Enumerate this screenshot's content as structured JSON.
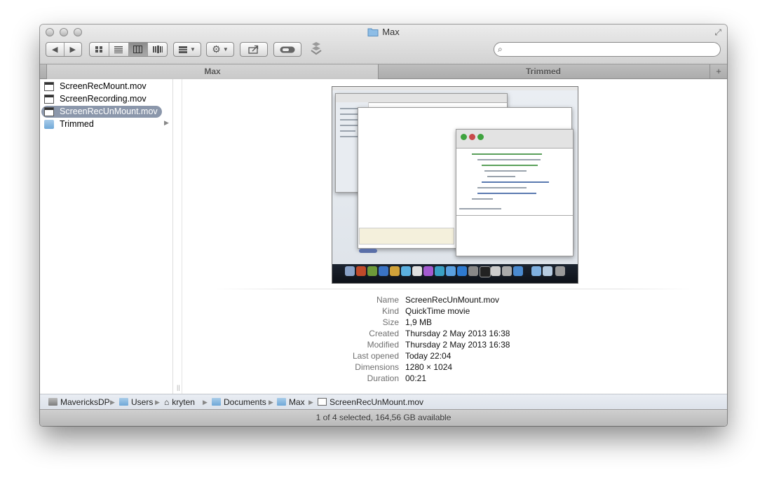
{
  "window": {
    "title": "Max"
  },
  "toolbar": {
    "back_icon": "back-arrow-icon",
    "forward_icon": "forward-arrow-icon",
    "view_modes": [
      "icon-view-icon",
      "list-view-icon",
      "column-view-icon",
      "coverflow-view-icon"
    ],
    "active_view": "column-view-icon",
    "arrange_icon": "arrange-grid-icon",
    "action_icon": "gear-icon",
    "share_icon": "share-icon",
    "tags_icon": "tag-toggle-icon",
    "dropbox_icon": "dropbox-icon",
    "search": {
      "placeholder": "",
      "value": ""
    }
  },
  "tabs": [
    {
      "label": "Max",
      "active": true
    },
    {
      "label": "Trimmed",
      "active": false
    }
  ],
  "column": {
    "items": [
      {
        "label": "ScreenRecMount.mov",
        "icon": "movie-file-icon",
        "selected": false
      },
      {
        "label": "ScreenRecording.mov",
        "icon": "movie-file-icon",
        "selected": false
      },
      {
        "label": "ScreenRecUnMount.mov",
        "icon": "movie-file-icon",
        "selected": true
      },
      {
        "label": "Trimmed",
        "icon": "folder-icon",
        "selected": false
      }
    ]
  },
  "info": [
    {
      "label": "Name",
      "value": "ScreenRecUnMount.mov"
    },
    {
      "label": "Kind",
      "value": "QuickTime movie"
    },
    {
      "label": "Size",
      "value": "1,9 MB"
    },
    {
      "label": "Created",
      "value": "Thursday 2 May 2013 16:38"
    },
    {
      "label": "Modified",
      "value": "Thursday 2 May 2013 16:38"
    },
    {
      "label": "Last opened",
      "value": "Today 22:04"
    },
    {
      "label": "Dimensions",
      "value": "1280 × 1024"
    },
    {
      "label": "Duration",
      "value": "00:21"
    }
  ],
  "path": [
    {
      "label": "MavericksDP",
      "icon": "hard-disk-icon"
    },
    {
      "label": "Users",
      "icon": "folder-icon"
    },
    {
      "label": "kryten",
      "icon": "home-icon"
    },
    {
      "label": "Documents",
      "icon": "documents-folder-icon"
    },
    {
      "label": "Max",
      "icon": "folder-icon"
    },
    {
      "label": "ScreenRecUnMount.mov",
      "icon": "movie-file-icon"
    }
  ],
  "status": "1 of 4 selected, 164,56 GB available"
}
